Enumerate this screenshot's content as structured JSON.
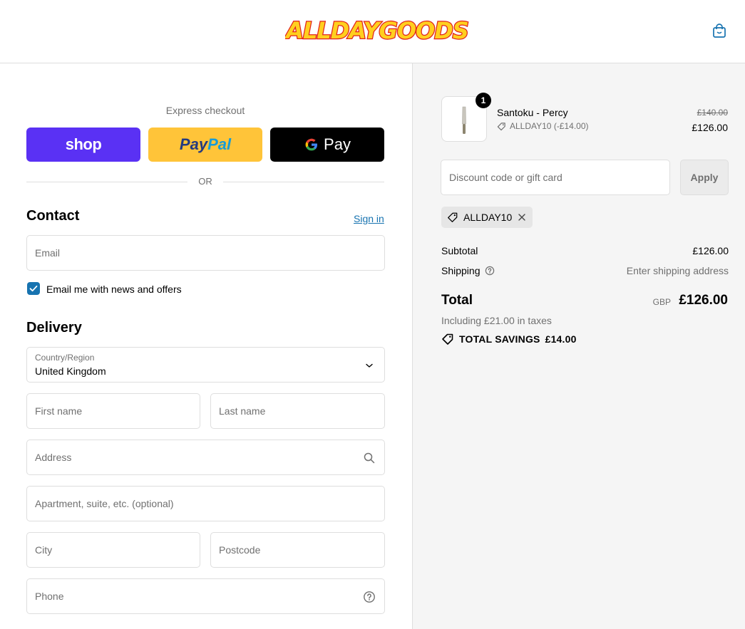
{
  "brand": {
    "logo_text": "ALLDAYGOODS",
    "logo_fill": "#ffcf1f",
    "logo_stroke": "#e2211c"
  },
  "express": {
    "title": "Express checkout",
    "shop_label": "shop",
    "paypal_label_a": "Pay",
    "paypal_label_b": "Pal",
    "gpay_label": "Pay",
    "or_label": "OR"
  },
  "contact": {
    "title": "Contact",
    "sign_in": "Sign in",
    "email_placeholder": "Email",
    "newsletter_label": "Email me with news and offers",
    "newsletter_checked": true
  },
  "delivery": {
    "title": "Delivery",
    "country_label": "Country/Region",
    "country_value": "United Kingdom",
    "first_name_placeholder": "First name",
    "last_name_placeholder": "Last name",
    "address_placeholder": "Address",
    "apartment_placeholder": "Apartment, suite, etc. (optional)",
    "city_placeholder": "City",
    "postcode_placeholder": "Postcode",
    "phone_placeholder": "Phone"
  },
  "order": {
    "item": {
      "name": "Santoku - Percy",
      "quantity": "1",
      "discount_note": "ALLDAY10 (-£14.00)",
      "original_price": "£140.00",
      "price": "£126.00"
    },
    "discount_placeholder": "Discount code or gift card",
    "apply_label": "Apply",
    "applied_code": "ALLDAY10",
    "subtotal_label": "Subtotal",
    "subtotal_value": "£126.00",
    "shipping_label": "Shipping",
    "shipping_value": "Enter shipping address",
    "total_label": "Total",
    "total_currency": "GBP",
    "total_value": "£126.00",
    "tax_note": "Including £21.00 in taxes",
    "savings_label": "TOTAL SAVINGS",
    "savings_value": "£14.00"
  },
  "colors": {
    "accent": "#1773b0",
    "shop_pay": "#5a31f4",
    "paypal": "#ffc439",
    "summary_bg": "#f5f5f5"
  }
}
